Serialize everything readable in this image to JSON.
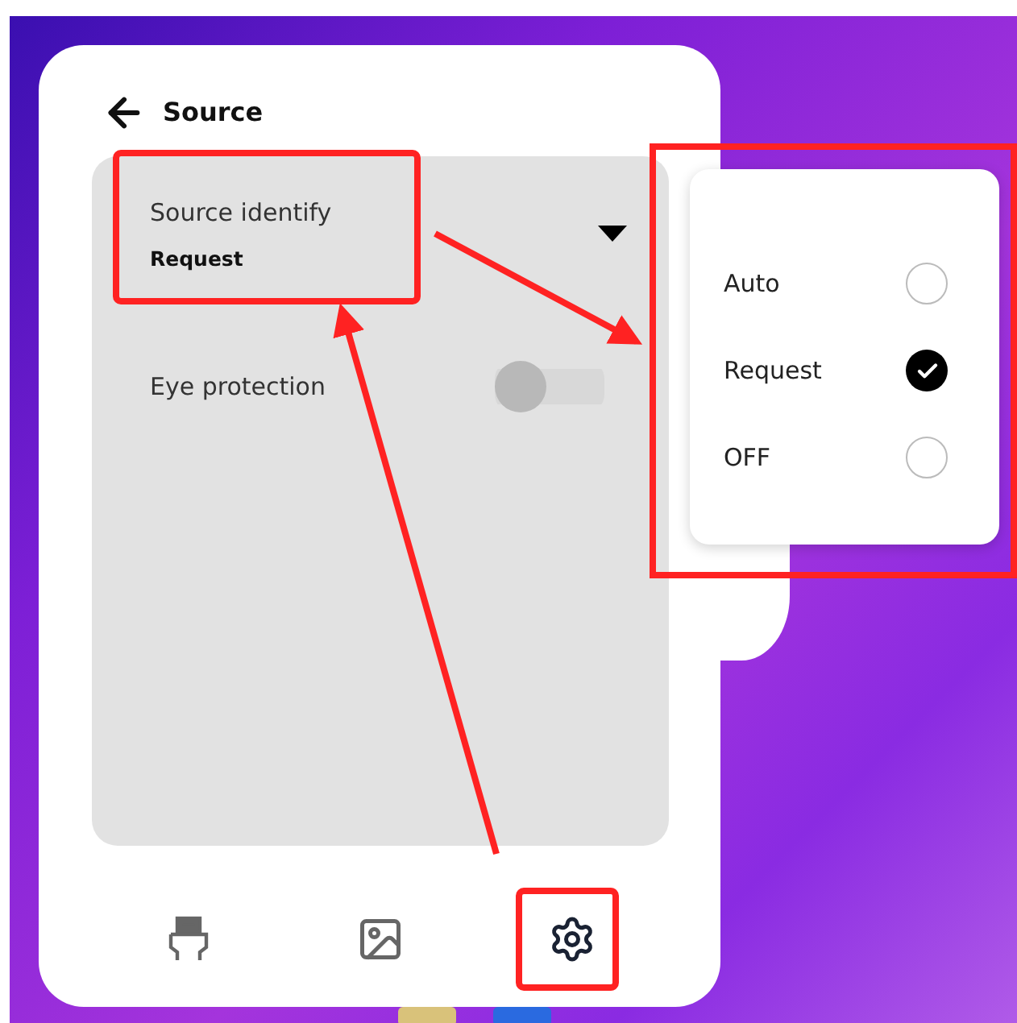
{
  "header": {
    "title": "Source"
  },
  "settings": [
    {
      "kind": "dropdown",
      "label": "Source identify",
      "value": "Request"
    },
    {
      "kind": "toggle",
      "label": "Eye protection",
      "on": false
    }
  ],
  "menu": {
    "options": [
      {
        "label": "Auto",
        "selected": false
      },
      {
        "label": "Request",
        "selected": true
      },
      {
        "label": "OFF",
        "selected": false
      }
    ]
  },
  "nav": [
    {
      "kind": "input",
      "selected": false
    },
    {
      "kind": "picture",
      "selected": false
    },
    {
      "kind": "settings",
      "selected": true
    }
  ]
}
